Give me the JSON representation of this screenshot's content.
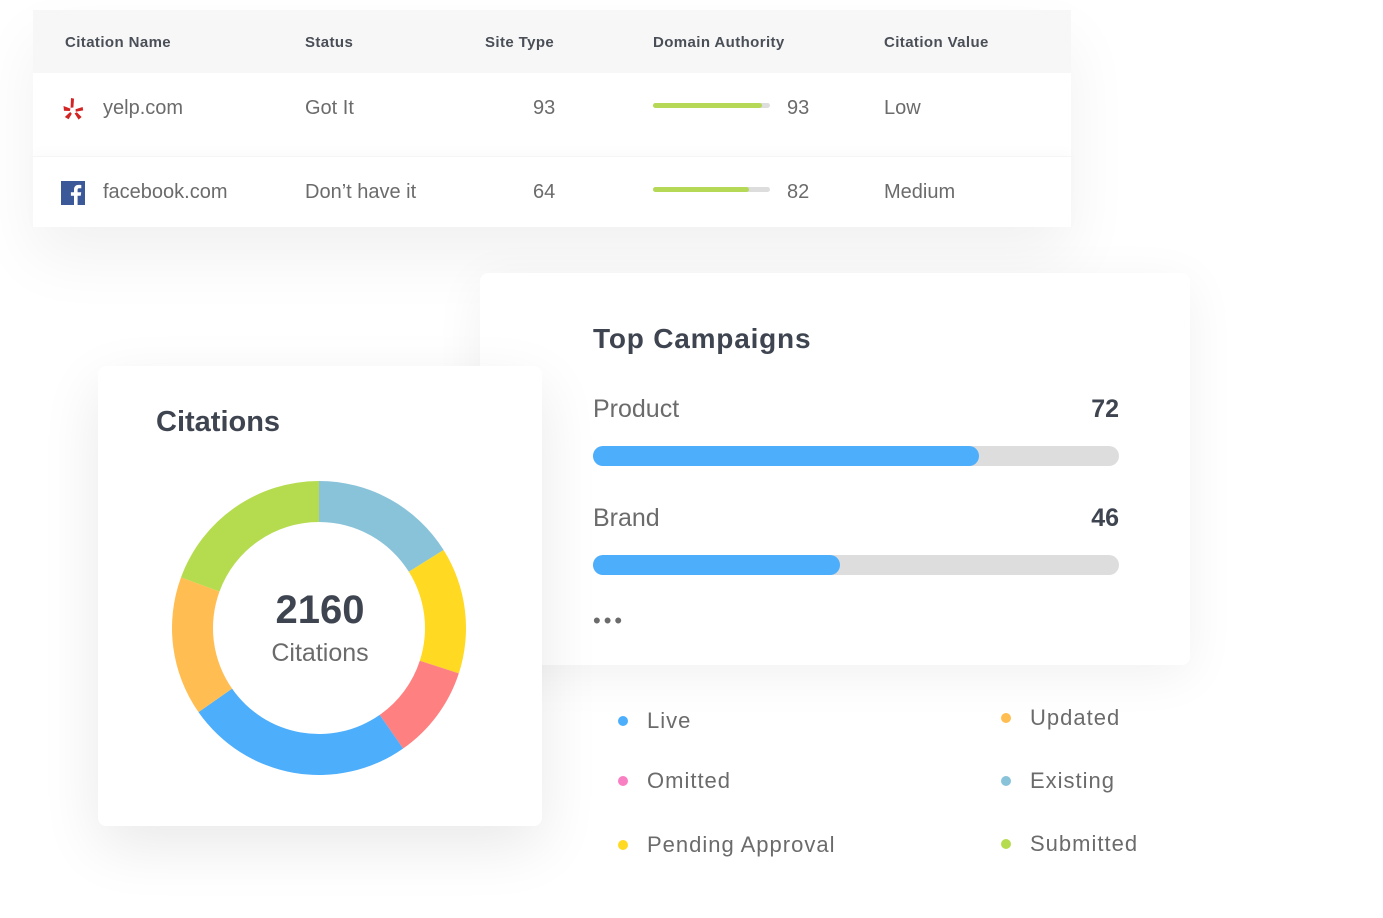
{
  "table": {
    "headers": [
      "Citation Name",
      "Status",
      "Site Type",
      "Domain Authority",
      "Citation Value"
    ],
    "rows": [
      {
        "icon": "yelp-icon",
        "name": "yelp.com",
        "status": "Got It",
        "site_type": "93",
        "domain_authority": 93,
        "domain_authority_label": "93",
        "citation_value": "Low"
      },
      {
        "icon": "facebook-icon",
        "name": "facebook.com",
        "status": "Don’t have it",
        "site_type": "64",
        "domain_authority": 82,
        "domain_authority_label": "82",
        "citation_value": "Medium"
      }
    ],
    "bar_color": "#b5d957"
  },
  "campaigns": {
    "title": "Top Campaigns",
    "items": [
      {
        "label": "Product",
        "value": 72,
        "value_label": "72"
      },
      {
        "label": "Brand",
        "value": 46,
        "value_label": "46"
      }
    ],
    "max": 98,
    "more": "•••",
    "bar_color": "#4daefc"
  },
  "citations": {
    "title": "Citations",
    "total": "2160",
    "subtitle": "Citations",
    "segments": [
      {
        "name": "Existing",
        "fraction": 0.161,
        "color": "#89c3d9"
      },
      {
        "name": "Pending Approval",
        "fraction": 0.139,
        "color": "#ffd922"
      },
      {
        "name": "Omitted",
        "fraction": 0.103,
        "color": "#ff8080"
      },
      {
        "name": "Live",
        "fraction": 0.25,
        "color": "#4daefc"
      },
      {
        "name": "Updated",
        "fraction": 0.153,
        "color": "#ffbd52"
      },
      {
        "name": "Submitted",
        "fraction": 0.194,
        "color": "#b5dc4e"
      }
    ]
  },
  "legend": [
    {
      "label": "Live",
      "color": "#4daefc"
    },
    {
      "label": "Updated",
      "color": "#ffbd52"
    },
    {
      "label": "Omitted",
      "color": "#f97fc3"
    },
    {
      "label": "Existing",
      "color": "#89c3d9"
    },
    {
      "label": "Pending Approval",
      "color": "#ffd922"
    },
    {
      "label": "Submitted",
      "color": "#b5dc4e"
    }
  ]
}
